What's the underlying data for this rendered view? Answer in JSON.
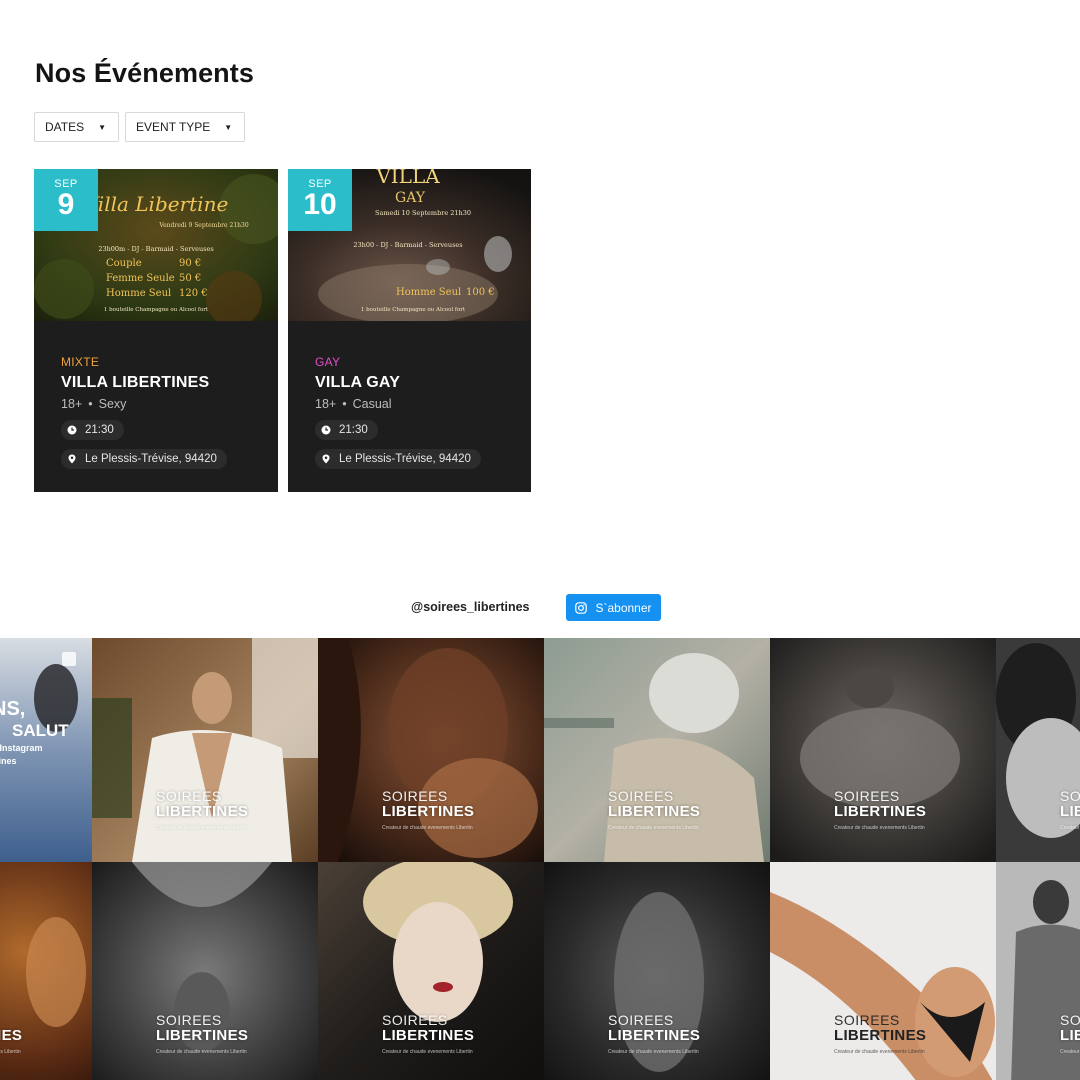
{
  "page": {
    "title": "Nos Événements"
  },
  "filters": [
    {
      "label": "DATES"
    },
    {
      "label": "EVENT TYPE"
    }
  ],
  "events": [
    {
      "month": "SEP",
      "day": "9",
      "category": "MIXTE",
      "category_color": "#f0a23a",
      "title": "VILLA LIBERTINES",
      "age": "18+",
      "style": "Sexy",
      "time": "21:30",
      "location": "Le Plessis-Trévise, 94420",
      "poster": {
        "heading": "Villa Libertine",
        "date_line": "Vendredi 9 Septembre 21h30",
        "services": "23h00m - DJ - Barmaid - Serveuses",
        "prices": [
          {
            "label": "Couple",
            "price": "90 €"
          },
          {
            "label": "Femme Seule",
            "price": "50 €"
          },
          {
            "label": "Homme Seul",
            "price": "120 €"
          }
        ],
        "footer": "1 bouteille Champagne ou Alcool fort"
      }
    },
    {
      "month": "SEP",
      "day": "10",
      "category": "GAY",
      "category_color": "#e04fc8",
      "title": "VILLA GAY",
      "age": "18+",
      "style": "Casual",
      "time": "21:30",
      "location": "Le Plessis-Trévise, 94420",
      "poster": {
        "heading": "VILLA",
        "subheading": "GAY",
        "date_line": "Samedi 10 Septembre 21h30",
        "services": "23h00 - DJ - Barmaid - Serveuses",
        "prices": [
          {
            "label": "Homme Seul",
            "price": "100 €"
          }
        ],
        "footer": "1 bouteille Champagne ou Alcool fort"
      }
    }
  ],
  "instagram": {
    "handle": "@soirees_libertines",
    "subscribe_label": "S`abonner",
    "first_tile_text": {
      "line1": "NS,",
      "line2": "SALUT",
      "line3": "e Instagram",
      "line4": "rtines"
    },
    "overlay": {
      "line1": "SOIREES",
      "line2": "LIBERTINES",
      "line3": "Createur de chaude evenements Libertin"
    }
  }
}
